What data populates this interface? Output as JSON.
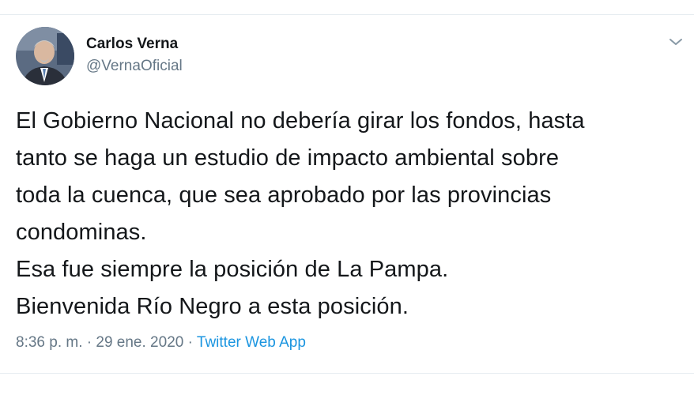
{
  "user": {
    "display_name": "Carlos Verna",
    "handle": "@VernaOficial"
  },
  "tweet": {
    "lines": [
      "El Gobierno Nacional no debería girar los fondos, hasta",
      "tanto se haga un estudio de impacto ambiental sobre",
      "toda la cuenca, que sea aprobado por las provincias",
      "condominas.",
      "Esa fue siempre la posición de La Pampa.",
      "Bienvenida Río Negro a esta posición."
    ],
    "time": "8:36 p. m.",
    "date": "29 ene. 2020",
    "separator": "·",
    "source": "Twitter Web App"
  },
  "icons": {
    "caret": "chevron-down-icon"
  },
  "colors": {
    "text": "#14171a",
    "secondary": "#657786",
    "link": "#1b95e0",
    "border": "#e6ecf0"
  }
}
